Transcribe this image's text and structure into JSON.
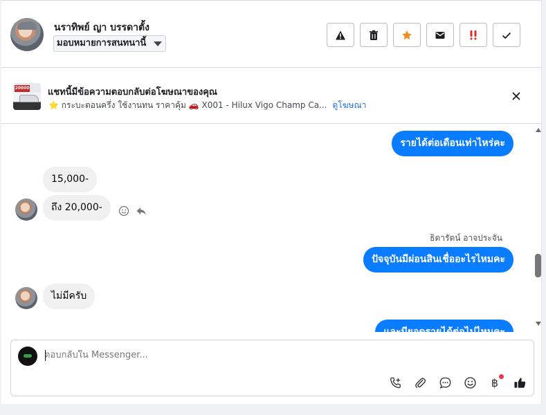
{
  "header": {
    "contact_name": "นราทิพย์ ญา บรรดาตั้ง",
    "assign_label": "มอบหมายการสนทนานี้",
    "actions": [
      {
        "icon": "warning-icon"
      },
      {
        "icon": "trash-icon"
      },
      {
        "icon": "star-icon"
      },
      {
        "icon": "mail-icon"
      },
      {
        "icon": "urgent-icon"
      },
      {
        "icon": "check-icon"
      }
    ],
    "colors": {
      "star": "#f28b1c",
      "urgent": "#d93025"
    }
  },
  "ad_bar": {
    "thumbnail_badge": "20000",
    "title": "แชทนี้มีข้อความตอบกลับต่อโฆษณาของคุณ",
    "text": "⭐ กระบะตอนครึ่ง ใช้งานทน ราคาคุ้ม 🚗 X001 - Hilux Vigo Champ Ca...",
    "link_label": "ดูโฆษณา"
  },
  "messages": [
    {
      "type": "out",
      "text": "รายได้ต่อเดือนเท่าไหร่คะ"
    },
    {
      "type": "in",
      "text": "15,000-"
    },
    {
      "type": "in",
      "text": "ถึง 20,000-"
    },
    {
      "type": "sender",
      "text": "ธิดารัตน์ อาจประจัน"
    },
    {
      "type": "out",
      "text": "ปัจจุบันมีผ่อนสินเชื่ออะไรไหมคะ"
    },
    {
      "type": "in",
      "text": "ไม่มีครับ"
    },
    {
      "type": "out",
      "text": "และมียอดรายได้ต่อไปไหมคะ"
    }
  ],
  "composer": {
    "placeholder": "ตอบกลับใน Messenger...",
    "tools": [
      {
        "icon": "call-add-icon"
      },
      {
        "icon": "paperclip-icon"
      },
      {
        "icon": "chat-bubble-icon"
      },
      {
        "icon": "emoji-icon"
      },
      {
        "icon": "baht-icon",
        "label": "฿"
      },
      {
        "icon": "thumbs-up-icon"
      }
    ],
    "notification_dot_color": "#e63946"
  },
  "colors": {
    "accent": "#0a7cff",
    "incoming_bubble": "#f0f0f0",
    "link": "#216fdb"
  }
}
